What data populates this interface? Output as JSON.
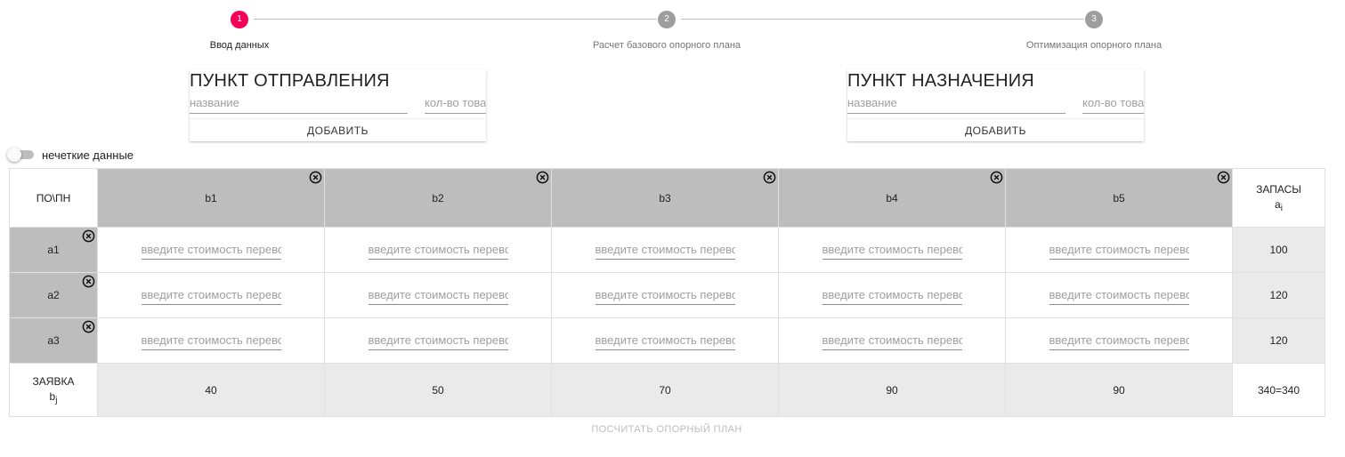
{
  "stepper": {
    "steps": [
      {
        "number": "1",
        "label": "Ввод данных",
        "state": "active"
      },
      {
        "number": "2",
        "label": "Расчет базового опорного плана",
        "state": "inactive"
      },
      {
        "number": "3",
        "label": "Оптимизация опорного плана",
        "state": "inactive"
      }
    ],
    "active_color": "#f50057",
    "inactive_color": "#9e9e9e"
  },
  "origin_card": {
    "title": "ПУНКТ ОТПРАВЛЕНИЯ",
    "name_placeholder": "название",
    "qty_placeholder": "кол-во товара",
    "add_label": "ДОБАВИТЬ"
  },
  "destination_card": {
    "title": "ПУНКТ НАЗНАЧЕНИЯ",
    "name_placeholder": "название",
    "qty_placeholder": "кол-во товара",
    "add_label": "ДОБАВИТЬ"
  },
  "fuzzy_toggle": {
    "label": "нечеткие данные",
    "checked": false
  },
  "table": {
    "corner_label": "ПО\\ПН",
    "supply_header": "ЗАПАСЫ",
    "supply_header_sub": "a",
    "supply_header_subscript": "i",
    "demand_label": "ЗАЯВКА",
    "demand_label_sub": "b",
    "demand_label_subscript": "j",
    "cost_placeholder": "введите стоимость перевозки",
    "columns": [
      "b1",
      "b2",
      "b3",
      "b4",
      "b5"
    ],
    "rows": [
      {
        "name": "a1",
        "supply": "100"
      },
      {
        "name": "a2",
        "supply": "120"
      },
      {
        "name": "a3",
        "supply": "120"
      }
    ],
    "demands": [
      "40",
      "50",
      "70",
      "90",
      "90"
    ],
    "balance": "340=340"
  },
  "calculate_button": {
    "label": "ПОСЧИТАТЬ ОПОРНЫЙ ПЛАН",
    "disabled": true
  },
  "icons": {
    "remove": "close-circle-icon"
  }
}
